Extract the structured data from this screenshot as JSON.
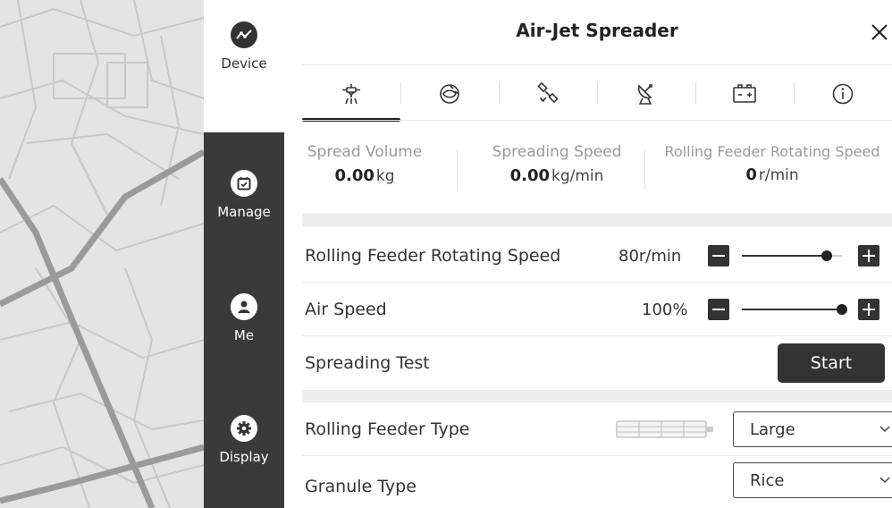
{
  "window": {
    "title": "Air-Jet Spreader",
    "close_icon": "close-icon"
  },
  "sidebar": {
    "items": [
      {
        "label": "Device",
        "icon": "device-icon",
        "active": true
      },
      {
        "label": "Manage",
        "icon": "calendar-check-icon",
        "active": false
      },
      {
        "label": "Me",
        "icon": "user-icon",
        "active": false
      },
      {
        "label": "Display",
        "icon": "gear-icon",
        "active": false
      }
    ]
  },
  "tabs": [
    {
      "icon": "spreader-icon",
      "selected": true
    },
    {
      "icon": "motor-icon",
      "selected": false
    },
    {
      "icon": "satellite-icon",
      "selected": false
    },
    {
      "icon": "antenna-dish-icon",
      "selected": false
    },
    {
      "icon": "battery-icon",
      "selected": false
    },
    {
      "icon": "info-icon",
      "selected": false
    }
  ],
  "stats": {
    "spread_volume": {
      "label": "Spread Volume",
      "value": "0.00",
      "unit": "kg"
    },
    "spreading_speed": {
      "label": "Spreading Speed",
      "value": "0.00",
      "unit": "kg/min"
    },
    "feeder_speed": {
      "label": "Rolling Feeder Rotating Speed",
      "value": "0",
      "unit": "r/min"
    }
  },
  "controls": {
    "feeder_speed": {
      "label": "Rolling Feeder Rotating Speed",
      "value": "80r/min",
      "level": 0.85
    },
    "air_speed": {
      "label": "Air Speed",
      "value": "100%",
      "level": 1.0
    },
    "spreading_test": {
      "label": "Spreading Test",
      "button": "Start"
    },
    "feeder_type": {
      "label": "Rolling Feeder Type",
      "selected": "Large"
    },
    "granule_type": {
      "label": "Granule Type",
      "selected": "Rice"
    }
  },
  "colors": {
    "sidebar_bg": "#3a3a3a",
    "button_bg": "#333333",
    "band": "#eeeeee"
  }
}
